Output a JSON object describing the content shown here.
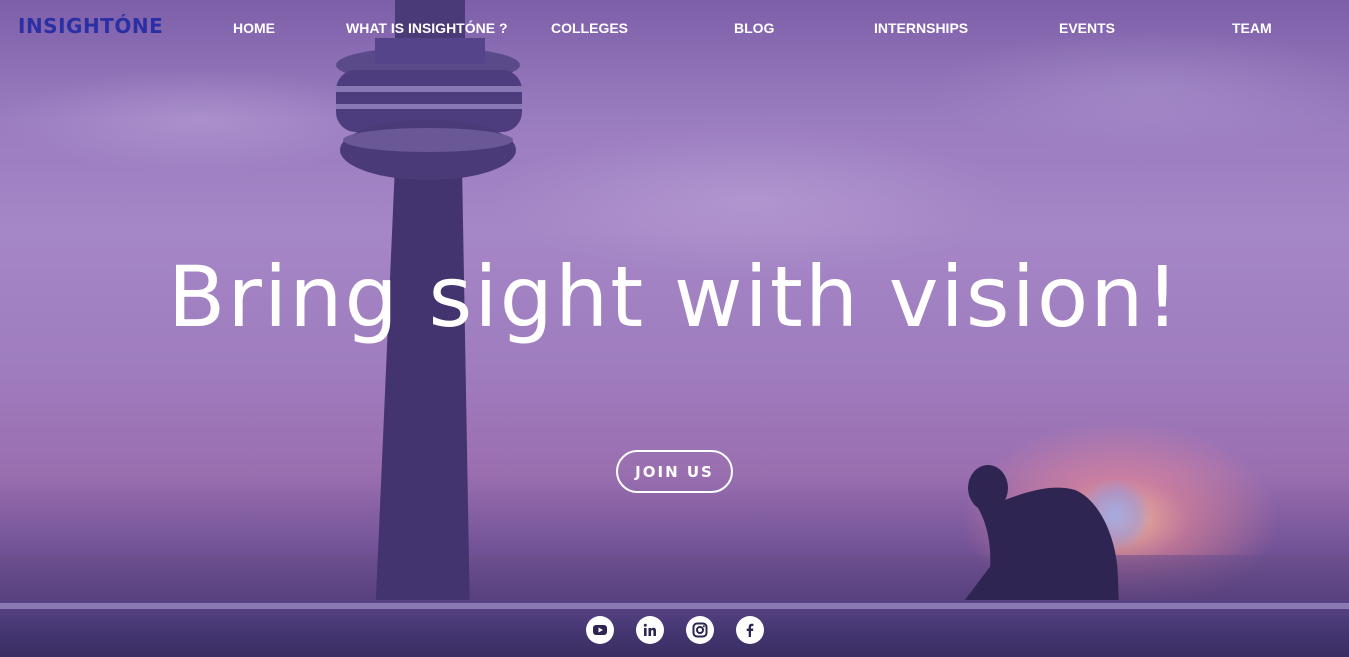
{
  "brand": {
    "logo_text": "INSIGHTÓNE"
  },
  "nav": {
    "items": [
      {
        "label": "HOME"
      },
      {
        "label": "WHAT IS INSIGHTÓNE ?"
      },
      {
        "label": "COLLEGES"
      },
      {
        "label": "BLOG"
      },
      {
        "label": "INTERNSHIPS"
      },
      {
        "label": "EVENTS"
      },
      {
        "label": "TEAM"
      }
    ]
  },
  "hero": {
    "headline": "Bring sight with vision!",
    "cta_label": "JOIN US"
  },
  "social": {
    "icons": [
      "youtube-icon",
      "linkedin-icon",
      "instagram-icon",
      "facebook-icon"
    ]
  },
  "colors": {
    "logo": "#2b2fa5",
    "overlay": "#9a7cc0",
    "text": "#ffffff"
  }
}
